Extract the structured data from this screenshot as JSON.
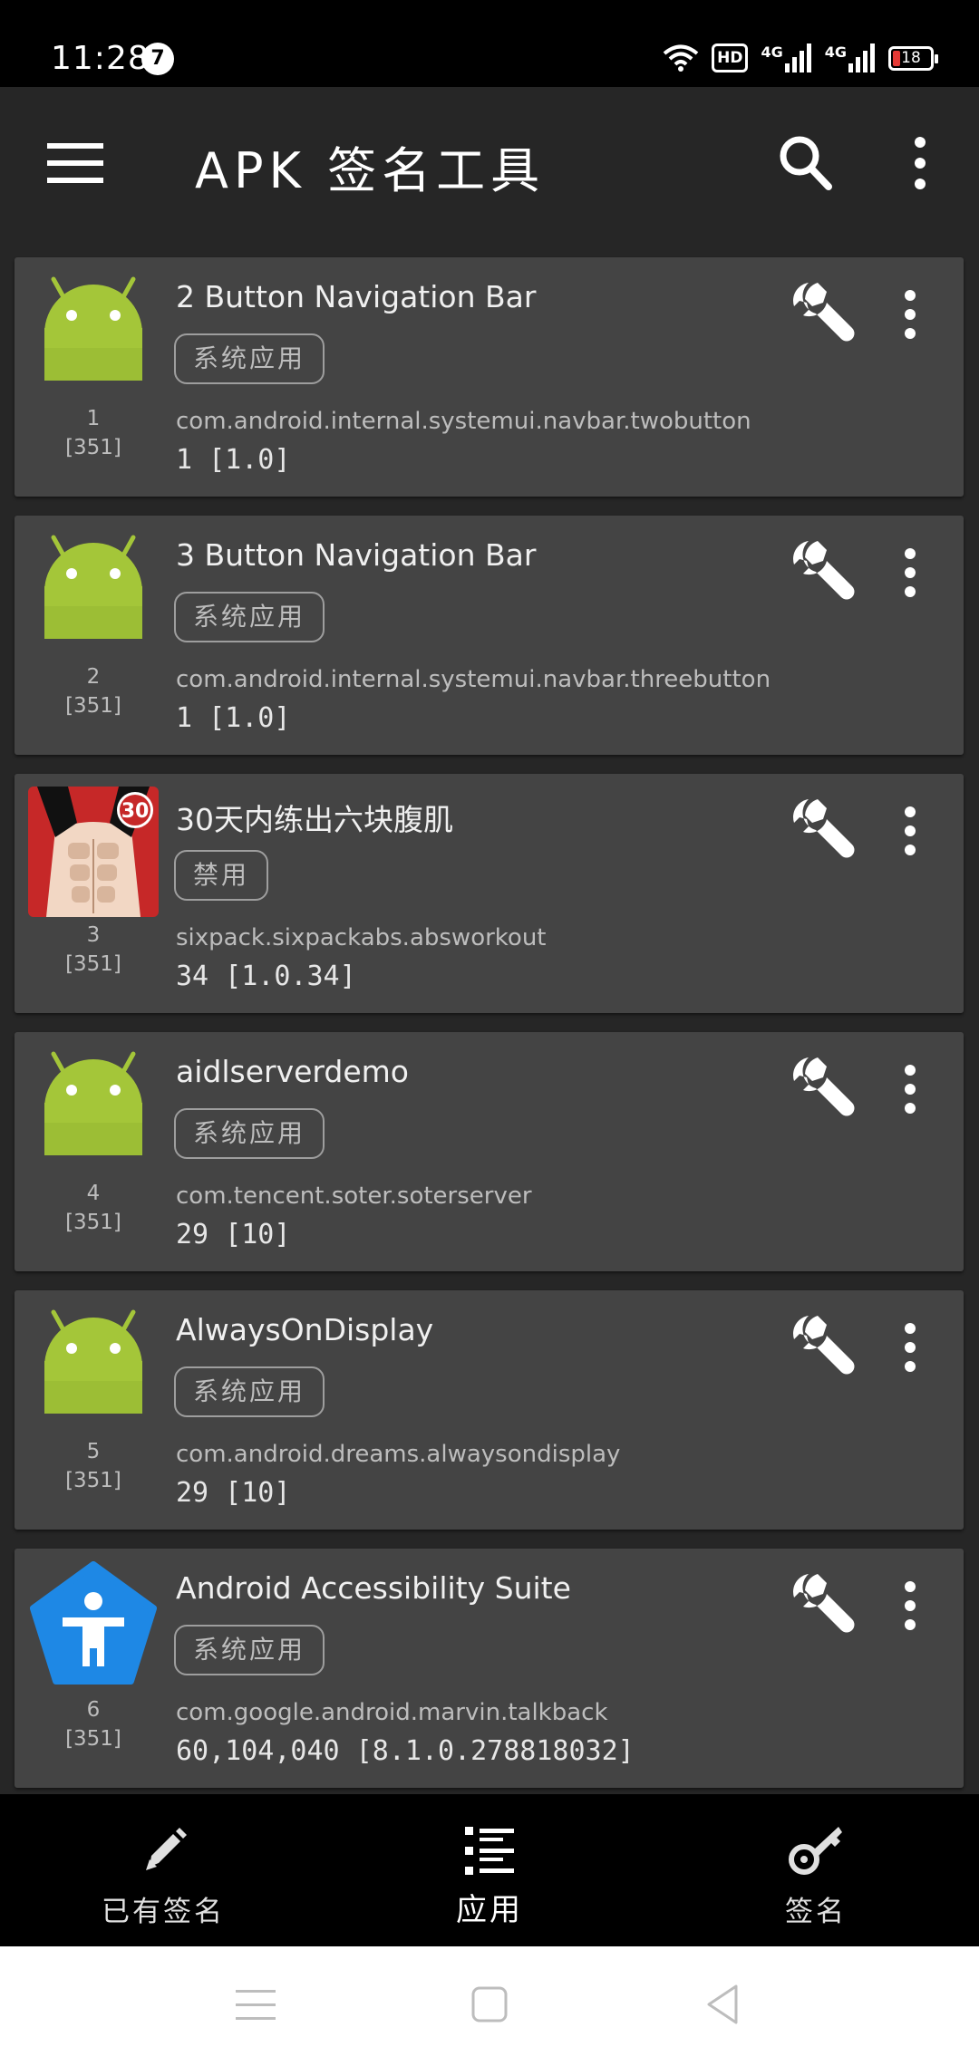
{
  "status_bar": {
    "time": "11:28",
    "notification_count": "7",
    "hd_label": "HD",
    "network_1": "4G",
    "network_2": "4G",
    "battery": "18"
  },
  "app_bar": {
    "title": "APK 签名工具"
  },
  "apps": [
    {
      "index": "1",
      "count": "[351]",
      "name": "2 Button Navigation Bar",
      "tag": "系统应用",
      "package": "com.android.internal.systemui.navbar.twobutton",
      "version": "1 [1.0]",
      "icon": "android-robot-icon"
    },
    {
      "index": "2",
      "count": "[351]",
      "name": "3 Button Navigation Bar",
      "tag": "系统应用",
      "package": "com.android.internal.systemui.navbar.threebutton",
      "version": "1 [1.0]",
      "icon": "android-robot-icon"
    },
    {
      "index": "3",
      "count": "[351]",
      "name": "30天内练出六块腹肌",
      "tag": "禁用",
      "package": "sixpack.sixpackabs.absworkout",
      "version": "34 [1.0.34]",
      "icon": "sixpack-app-icon"
    },
    {
      "index": "4",
      "count": "[351]",
      "name": "aidlserverdemo",
      "tag": "系统应用",
      "package": "com.tencent.soter.soterserver",
      "version": "29 [10]",
      "icon": "android-robot-icon"
    },
    {
      "index": "5",
      "count": "[351]",
      "name": "AlwaysOnDisplay",
      "tag": "系统应用",
      "package": "com.android.dreams.alwaysondisplay",
      "version": "29 [10]",
      "icon": "android-robot-icon"
    },
    {
      "index": "6",
      "count": "[351]",
      "name": "Android Accessibility Suite",
      "tag": "系统应用",
      "package": "com.google.android.marvin.talkback",
      "version": "60,104,040 [8.1.0.278818032]",
      "icon": "accessibility-icon"
    }
  ],
  "bottom_nav": {
    "items": [
      {
        "label": "已有签名",
        "icon": "pencil-icon"
      },
      {
        "label": "应用",
        "icon": "list-icon",
        "active": true
      },
      {
        "label": "签名",
        "icon": "key-icon"
      }
    ]
  },
  "colors": {
    "background": "#262626",
    "card": "#444444",
    "android_green": "#a4c639",
    "accessibility_blue": "#1e88e5"
  }
}
